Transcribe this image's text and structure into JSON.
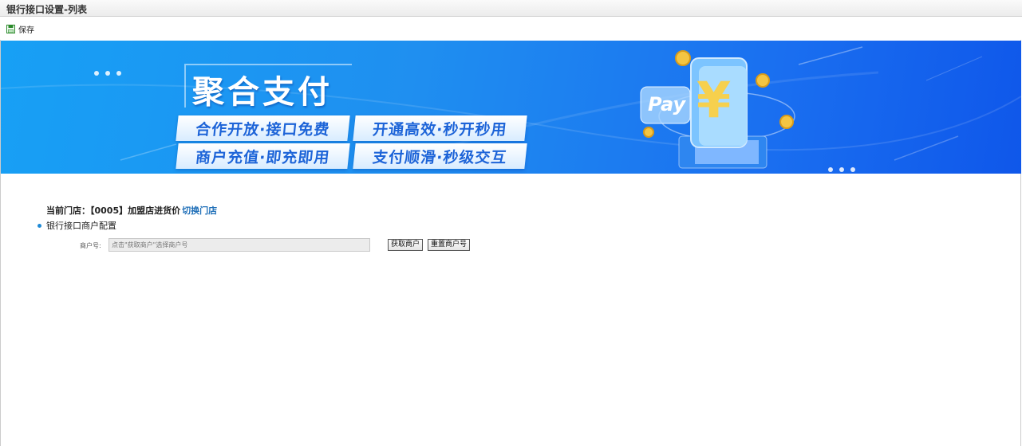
{
  "window": {
    "title": "银行接口设置-列表"
  },
  "toolbar": {
    "save_label": "保存"
  },
  "banner": {
    "title": "聚合支付",
    "tags": [
      "合作开放·接口免费",
      "开通高效·秒开秒用",
      "商户充值·即充即用",
      "支付顺滑·秒级交互"
    ],
    "pay_label": "Pay",
    "currency_symbol": "¥"
  },
  "store": {
    "prefix": "当前门店：",
    "name": "【0005】加盟店进货价",
    "switch_label": "切换门店"
  },
  "section": {
    "title": "银行接口商户配置"
  },
  "merchant": {
    "label": "商户号:",
    "placeholder": "点击\"获取商户\"选择商户号",
    "value": ""
  },
  "buttons": {
    "fetch_label": "获取商户",
    "reset_label": "重置商户号"
  }
}
